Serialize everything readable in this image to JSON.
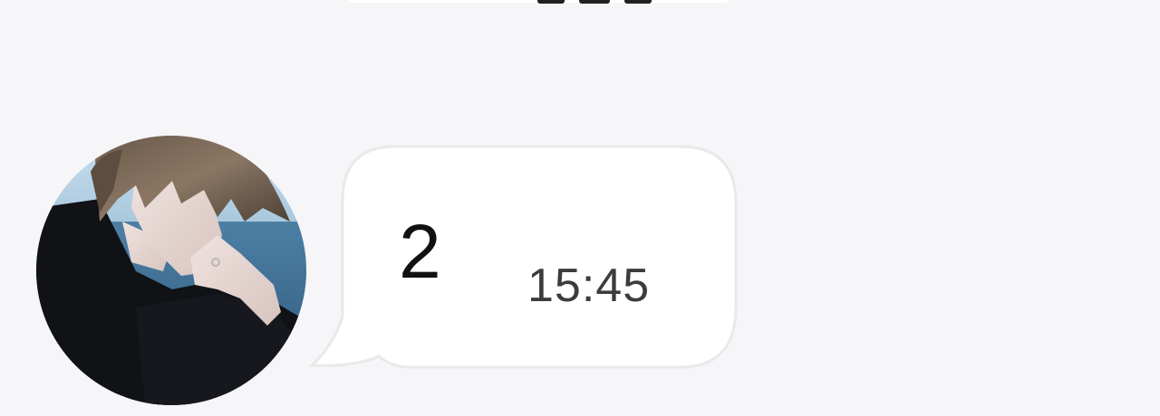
{
  "chat": {
    "message": {
      "text": "2",
      "time": "15:45"
    },
    "sender": {
      "avatar_icon": "person-photo-icon"
    }
  },
  "colors": {
    "background": "#f6f6f8",
    "bubble": "#ffffff",
    "bubble_border": "#e9e9ec",
    "message_text": "#111111",
    "time_text": "#3c3c3c"
  }
}
